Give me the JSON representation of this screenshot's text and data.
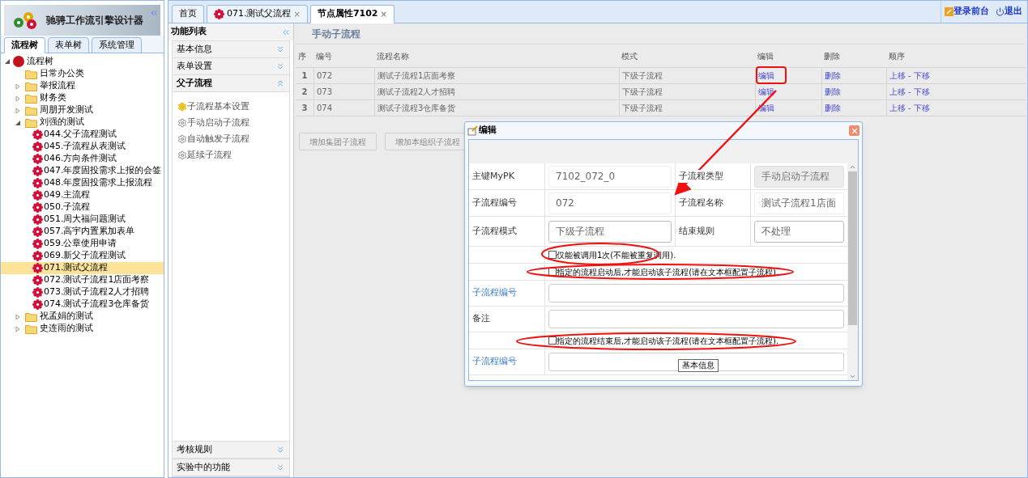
{
  "app": {
    "title": "驰骋工作流引擎设计器"
  },
  "left_tabs": [
    {
      "label": "流程树",
      "selected": true
    },
    {
      "label": "表单树",
      "selected": false
    },
    {
      "label": "系统管理",
      "selected": false
    }
  ],
  "tree": {
    "label": "流程树",
    "expanded": true,
    "children": [
      {
        "kind": "empty-folder",
        "label": "日常办公类"
      },
      {
        "kind": "folder",
        "label": "举报流程",
        "expanded": false
      },
      {
        "kind": "folder",
        "label": "财务类",
        "expanded": false
      },
      {
        "kind": "folder",
        "label": "周朋开发测试",
        "expanded": false
      },
      {
        "kind": "folder",
        "label": "刘强的测试",
        "expanded": true,
        "children": [
          {
            "kind": "flow",
            "label": "044.父子流程测试",
            "selected": false
          },
          {
            "kind": "flow",
            "label": "045.子流程从表测试",
            "selected": false
          },
          {
            "kind": "flow",
            "label": "046.方向条件测试",
            "selected": false
          },
          {
            "kind": "flow",
            "label": "047.年度固投需求上报的会签",
            "selected": false
          },
          {
            "kind": "flow",
            "label": "048.年度固投需求上报流程",
            "selected": false
          },
          {
            "kind": "flow",
            "label": "049.主流程",
            "selected": false
          },
          {
            "kind": "flow",
            "label": "050.子流程",
            "selected": false
          },
          {
            "kind": "flow",
            "label": "051.周大福问题测试",
            "selected": false
          },
          {
            "kind": "flow",
            "label": "057.高宇内置累加表单",
            "selected": false
          },
          {
            "kind": "flow",
            "label": "059.公章使用申请",
            "selected": false
          },
          {
            "kind": "flow",
            "label": "069.新父子流程测试",
            "selected": false
          },
          {
            "kind": "flow",
            "label": "071.测试父流程",
            "selected": true
          },
          {
            "kind": "flow",
            "label": "072.测试子流程1店面考察",
            "selected": false
          },
          {
            "kind": "flow",
            "label": "073.测试子流程2人才招聘",
            "selected": false
          },
          {
            "kind": "flow",
            "label": "074.测试子流程3仓库备货",
            "selected": false
          }
        ]
      },
      {
        "kind": "folder",
        "label": "祝孟娟的测试",
        "expanded": false
      },
      {
        "kind": "folder",
        "label": "史连雨的测试",
        "expanded": false
      }
    ]
  },
  "main_tabs": [
    {
      "kind": "home",
      "label": "首页",
      "selected": false
    },
    {
      "kind": "flow",
      "label": "071.测试父流程",
      "close": "×",
      "selected": false
    },
    {
      "kind": "page",
      "label": "节点属性7102",
      "close": "×",
      "selected": true
    }
  ],
  "top_links": [
    {
      "kind": "login",
      "label": "登录前台"
    },
    {
      "kind": "logout",
      "label": "退出"
    }
  ],
  "function_list": {
    "title": "功能列表",
    "sections": [
      {
        "label": "基本信息",
        "expanded": false
      },
      {
        "label": "表单设置",
        "expanded": false
      },
      {
        "label": "父子流程",
        "expanded": true,
        "items": [
          {
            "label": "子流程基本设置",
            "selected": true
          },
          {
            "label": "手动启动子流程",
            "selected": false
          },
          {
            "label": "自动触发子流程",
            "selected": false
          },
          {
            "label": "延续子流程",
            "selected": false
          }
        ]
      }
    ],
    "bottom_sections": [
      {
        "label": "考核规则",
        "expanded": false
      },
      {
        "label": "实验中的功能",
        "expanded": false
      }
    ]
  },
  "content": {
    "title": "手动子流程",
    "columns": [
      "序",
      "编号",
      "流程名称",
      "模式",
      "编辑",
      "删除",
      "顺序"
    ],
    "rows": [
      {
        "seq": "1",
        "no": "072",
        "name": "测试子流程1店面考察",
        "mode": "下级子流程",
        "edit": "编辑",
        "delete": "删除",
        "up": "上移",
        "sep": "-",
        "down": "下移"
      },
      {
        "seq": "2",
        "no": "073",
        "name": "测试子流程2人才招聘",
        "mode": "下级子流程",
        "edit": "编辑",
        "delete": "删除",
        "up": "上移",
        "sep": "-",
        "down": "下移"
      },
      {
        "seq": "3",
        "no": "074",
        "name": "测试子流程3仓库备货",
        "mode": "下级子流程",
        "edit": "编辑",
        "delete": "删除",
        "up": "上移",
        "sep": "-",
        "down": "下移"
      }
    ],
    "buttons": [
      "增加集团子流程",
      "增加本组织子流程"
    ]
  },
  "dialog": {
    "title": "编辑",
    "rows": [
      {
        "kind": "pair",
        "label": "主键MyPK",
        "field": {
          "kind": "plain",
          "value": "7102_072_0"
        },
        "label2": "子流程类型",
        "field2": {
          "kind": "greyed",
          "value": "手动启动子流程"
        }
      },
      {
        "kind": "pair",
        "label": "子流程编号",
        "field": {
          "kind": "plain",
          "value": "072"
        },
        "label2": "子流程名称",
        "field2": {
          "kind": "plain",
          "value": "测试子流程1店面"
        }
      },
      {
        "kind": "pair",
        "label": "子流程模式",
        "field": {
          "kind": "box",
          "value": "下级子流程"
        },
        "label2": "结束规则",
        "field2": {
          "kind": "box",
          "value": "不处理"
        }
      },
      {
        "kind": "check",
        "label": "仅能被调用1次(不能被重复调用).",
        "checked": false
      },
      {
        "kind": "check",
        "label": "指定的流程启动后,才能启动该子流程(请在文本框配置子流程).",
        "checked": false
      },
      {
        "kind": "linked-field",
        "label": "子流程编号"
      },
      {
        "kind": "field",
        "label": "备注"
      },
      {
        "kind": "check",
        "label": "指定的流程结束后,才能启动该子流程(请在文本框配置子流程).",
        "checked": false
      },
      {
        "kind": "linked-field",
        "label": "子流程编号",
        "tooltip": "基本信息"
      }
    ]
  }
}
